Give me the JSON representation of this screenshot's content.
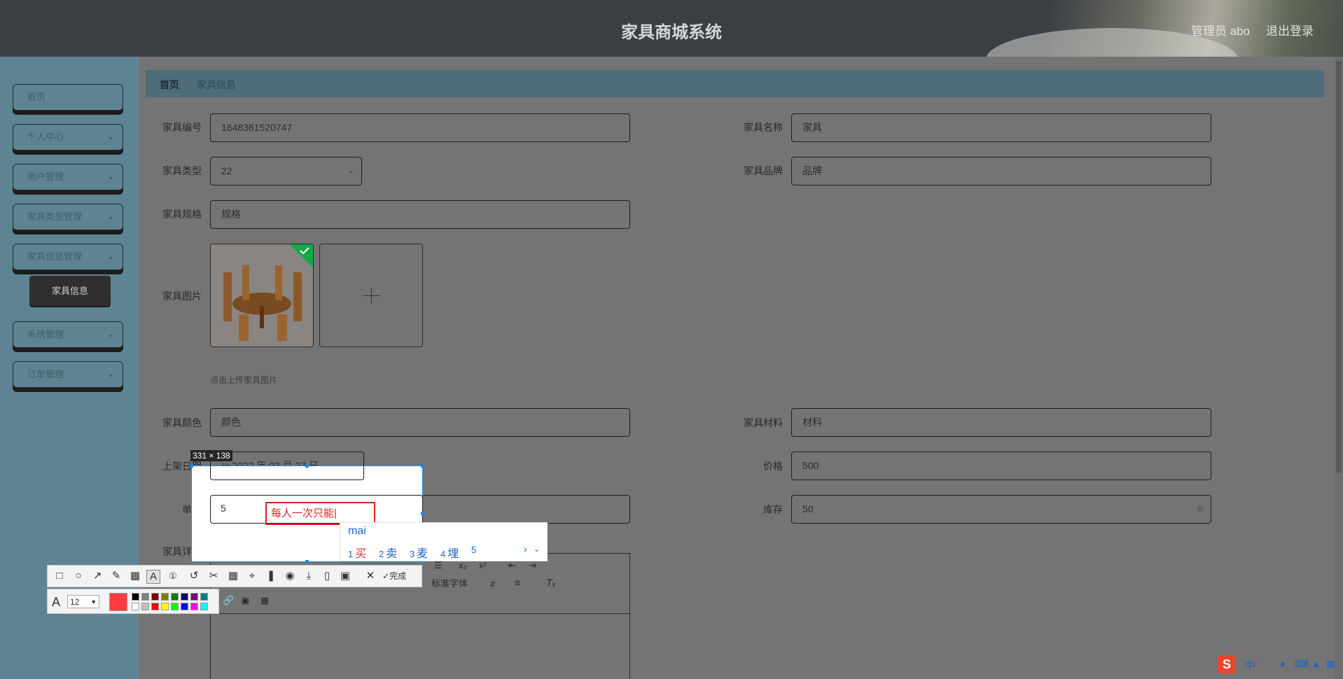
{
  "header": {
    "title": "家具商城系统",
    "admin": "管理员 abo",
    "logout": "退出登录"
  },
  "sidebar": {
    "items": [
      {
        "label": "首页"
      },
      {
        "label": "个人中心"
      },
      {
        "label": "用户管理"
      },
      {
        "label": "家具类型管理"
      },
      {
        "label": "家具信息管理"
      },
      {
        "label": "系统管理"
      },
      {
        "label": "订单管理"
      }
    ],
    "active_sub": "家具信息"
  },
  "breadcrumb": {
    "home": "首页",
    "current": "家具信息"
  },
  "form": {
    "code_label": "家具编号",
    "code_value": "1648361520747",
    "name_label": "家具名称",
    "name_value": "家具",
    "type_label": "家具类型",
    "type_value": "22",
    "brand_label": "家具品牌",
    "brand_value": "品牌",
    "spec_label": "家具规格",
    "spec_value": "规格",
    "image_label": "家具图片",
    "upload_hint": "点击上传家具图片",
    "color_label": "家具颜色",
    "color_value": "颜色",
    "material_label": "家具材料",
    "material_value": "材料",
    "date_label": "上架日期",
    "date_value": "2022 年 03 月 27 日",
    "price_label": "价格",
    "price_value": "500",
    "limit_label": "单限",
    "limit_value": "5",
    "stock_label": "库存",
    "stock_value": "50",
    "detail_label": "家具详情",
    "font_select": "标准字体"
  },
  "screenshot_tool": {
    "size": "331 × 138",
    "typed_text": "每人一次只能",
    "done_label": "完成",
    "font_size": "12",
    "active_color": "#ff3b3b",
    "palette": [
      "#000000",
      "#808080",
      "#800000",
      "#808000",
      "#008000",
      "#000080",
      "#800080",
      "#008080",
      "#ffffff",
      "#c0c0c0",
      "#ff0000",
      "#ffff00",
      "#00ff00",
      "#0000ff",
      "#ff00ff",
      "#00ffff"
    ]
  },
  "ime": {
    "pinyin": "mai",
    "candidates": [
      {
        "num": "1",
        "text": "买"
      },
      {
        "num": "2",
        "text": "卖"
      },
      {
        "num": "3",
        "text": "麦"
      },
      {
        "num": "4",
        "text": "埋"
      },
      {
        "num": "5",
        "text": ""
      }
    ]
  },
  "taskbar": {
    "ime_mode": "中",
    "ime_punct": "°,"
  }
}
